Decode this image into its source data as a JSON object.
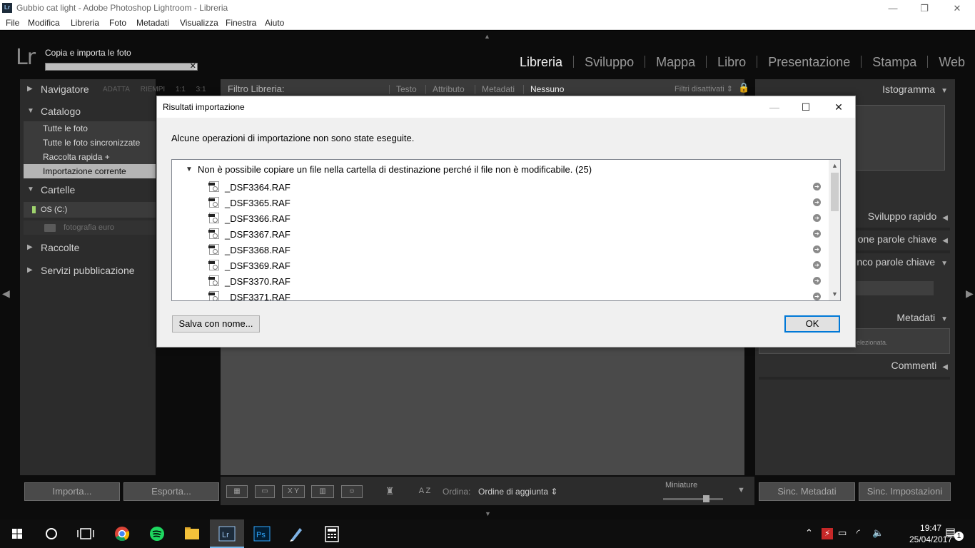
{
  "window": {
    "title": "Gubbio cat light - Adobe Photoshop Lightroom - Libreria",
    "app_icon": "Lr",
    "minimize": "—",
    "restore": "❐",
    "close": "✕"
  },
  "menu": [
    "File",
    "Modifica",
    "Libreria",
    "Foto",
    "Metadati",
    "Visualizza",
    "Finestra",
    "Aiuto"
  ],
  "lightroom": {
    "logo": "Lr",
    "import_status": "Copia e importa le foto",
    "import_progress": 0.98,
    "modules": [
      "Libreria",
      "Sviluppo",
      "Mappa",
      "Libro",
      "Presentazione",
      "Stampa",
      "Web"
    ],
    "active_module": "Libreria"
  },
  "left_panel": {
    "navigator": "Navigatore",
    "navigator_options": [
      "ADATTA",
      "RIEMPI",
      "1:1",
      "3:1"
    ],
    "catalog": "Catalogo",
    "catalog_items": [
      "Tutte le foto",
      "Tutte le foto sincronizzate",
      "Raccolta rapida +",
      "Importazione corrente"
    ],
    "selected_catalog_item": "Importazione corrente",
    "folders": "Cartelle",
    "drive": "OS (C:)",
    "folder": "fotografia euro",
    "collections": "Raccolte",
    "publish_services": "Servizi pubblicazione"
  },
  "filter_bar": {
    "label": "Filtro Libreria:",
    "filters": [
      "Testo",
      "Attributo",
      "Metadati",
      "Nessuno"
    ],
    "active_filter": "Nessuno",
    "presets": "Filtri disattivati ⇕"
  },
  "right_panel": {
    "histogram": "Istogramma",
    "quick_develop": "Sviluppo rapido",
    "keywording": "one parole chiave",
    "keyword_list": "nco parole chiave",
    "metadata": "Metadati",
    "metadata_note": "elezionata.",
    "comments": "Commenti"
  },
  "bottom": {
    "import_button": "Importa...",
    "export_button": "Esporta...",
    "sort_label": "Ordina:",
    "sort_value": "Ordine di aggiunta ⇕",
    "thumbnails_label": "Miniature",
    "thumbnail_size": 0.7,
    "sync_metadata": "Sinc. Metadati",
    "sync_settings": "Sinc. Impostazioni",
    "xy_label": "X Y",
    "az_label": "A Z"
  },
  "dialog": {
    "title": "Risultati importazione",
    "message": "Alcune operazioni di importazione non sono state eseguite.",
    "group_label": "Non è possibile copiare un file nella cartella di destinazione perché il file non è modificabile. (25)",
    "files": [
      "_DSF3364.RAF",
      "_DSF3365.RAF",
      "_DSF3366.RAF",
      "_DSF3367.RAF",
      "_DSF3368.RAF",
      "_DSF3369.RAF",
      "_DSF3370.RAF",
      "_DSF3371.RAF"
    ],
    "save_button": "Salva con nome...",
    "ok_button": "OK"
  },
  "taskbar": {
    "apps": [
      "windows-start",
      "cortana",
      "task-view",
      "chrome",
      "spotify",
      "file-explorer",
      "lightroom",
      "photoshop",
      "pen-tool",
      "calculator"
    ],
    "time": "19:47",
    "date": "25/04/2017",
    "notification_count": "1"
  }
}
